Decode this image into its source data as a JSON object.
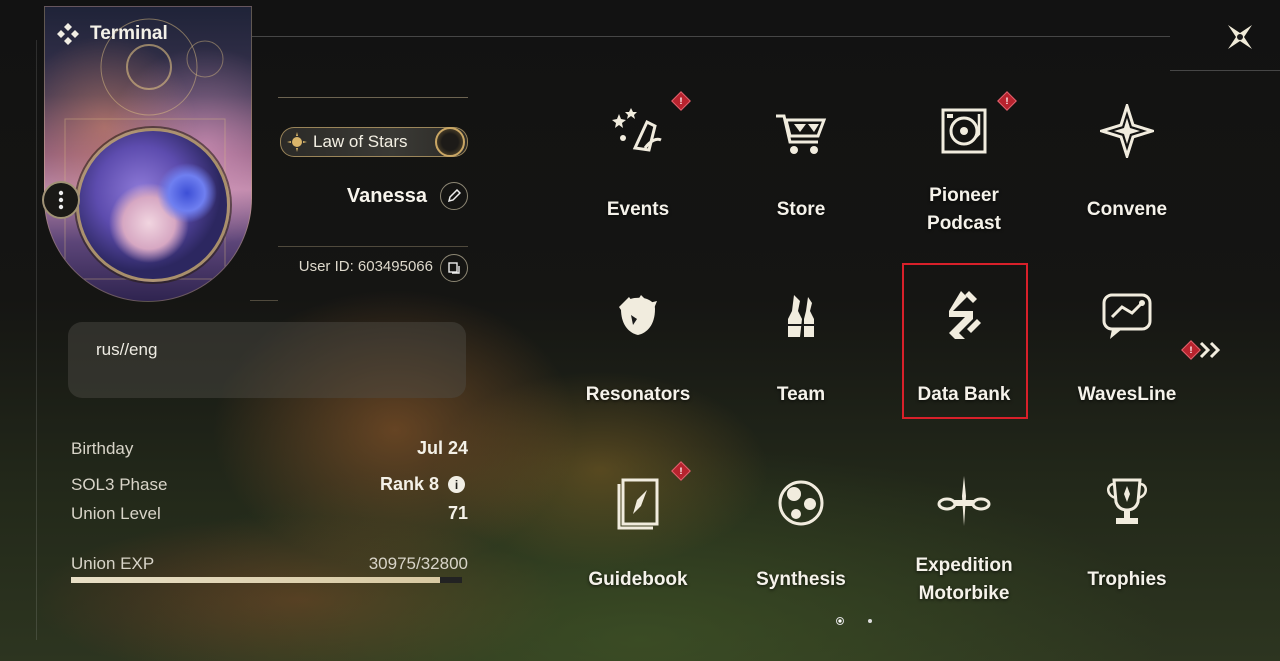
{
  "window": {
    "title": "Terminal"
  },
  "profile": {
    "title_badge": "Law of Stars",
    "username": "Vanessa",
    "user_id": "User ID: 603495066",
    "signature": "rus//eng",
    "stats": [
      {
        "label": "Birthday",
        "value": "Jul 24"
      },
      {
        "label": "SOL3 Phase",
        "value": "Rank 8"
      },
      {
        "label": "Union Level",
        "value": "71"
      }
    ],
    "union_exp": {
      "label": "Union EXP",
      "value": "30975/32800",
      "progress": 0.944
    }
  },
  "menu": {
    "tiles": [
      {
        "label": "Events",
        "icon": "events-icon",
        "alert": true
      },
      {
        "label": "Store",
        "icon": "store-cart-icon",
        "alert": false
      },
      {
        "label": "Pioneer\nPodcast",
        "icon": "podcast-turntable-icon",
        "alert": true
      },
      {
        "label": "Convene",
        "icon": "convene-star-icon",
        "alert": false
      },
      {
        "label": "Resonators",
        "icon": "resonator-head-icon",
        "alert": false
      },
      {
        "label": "Team",
        "icon": "team-figures-icon",
        "alert": false
      },
      {
        "label": "Data Bank",
        "icon": "data-bank-icon",
        "alert": false,
        "selected": true
      },
      {
        "label": "WavesLine",
        "icon": "chat-bubble-icon",
        "alert": false
      },
      {
        "label": "Guidebook",
        "icon": "guidebook-icon",
        "alert": true
      },
      {
        "label": "Synthesis",
        "icon": "synthesis-icon",
        "alert": false
      },
      {
        "label": "Expedition\nMotorbike",
        "icon": "motorbike-icon",
        "alert": false
      },
      {
        "label": "Trophies",
        "icon": "trophy-icon",
        "alert": false
      }
    ],
    "next_page_alert": true,
    "page_count": 2,
    "current_page": 1
  },
  "colors": {
    "accent_gold": "#c9a664",
    "alert_red": "#b8232e",
    "highlight_red": "#d8202a"
  }
}
